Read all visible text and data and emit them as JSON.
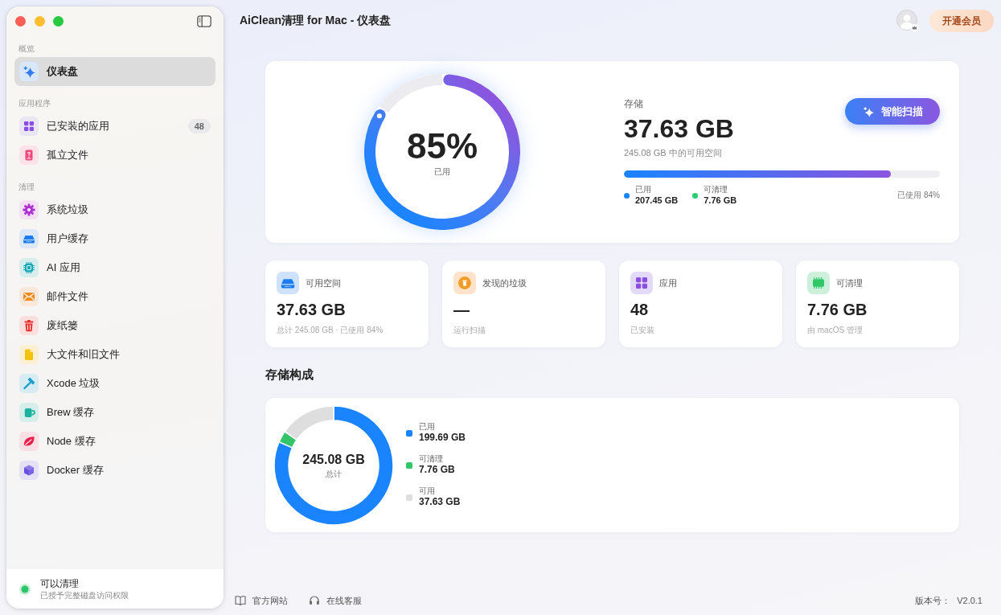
{
  "window": {
    "title": "AiClean清理 for Mac - 仪表盘"
  },
  "sidebar": {
    "sections": [
      {
        "title": "概览",
        "items": [
          {
            "label": "仪表盘",
            "selected": true
          }
        ]
      },
      {
        "title": "应用程序",
        "items": [
          {
            "label": "已安装的应用",
            "selected": false,
            "badge": "48"
          },
          {
            "label": "孤立文件",
            "selected": false
          }
        ]
      },
      {
        "title": "清理",
        "items": [
          {
            "label": "系统垃圾",
            "selected": false
          },
          {
            "label": "用户缓存",
            "selected": false
          },
          {
            "label": "AI 应用",
            "selected": false
          },
          {
            "label": "邮件文件",
            "selected": false
          },
          {
            "label": "废纸篓",
            "selected": false
          },
          {
            "label": "大文件和旧文件",
            "selected": false
          },
          {
            "label": "Xcode 垃圾",
            "selected": false
          },
          {
            "label": "Brew 缓存",
            "selected": false
          },
          {
            "label": "Node 缓存",
            "selected": false
          },
          {
            "label": "Docker 缓存",
            "selected": false
          }
        ]
      }
    ],
    "status": {
      "title": "可以清理",
      "detail": "已授予完整磁盘访问权限",
      "ok": true
    }
  },
  "header": {
    "upgrade_button": "开通会员"
  },
  "storage": {
    "ring": {
      "percent": "85%",
      "caption": "已用",
      "chart_data": {
        "type": "donut",
        "values": [
          85,
          15
        ]
      }
    },
    "label": "存储",
    "value": "37.63 GB",
    "detail": "245.08 GB 中的可用空间",
    "scan_button": "智能扫描",
    "bar": {
      "level": 0.846
    },
    "legend": [
      {
        "label": "已用",
        "value": "207.45 GB",
        "color": "#1a84ff"
      },
      {
        "label": "可清理",
        "value": "7.76 GB",
        "color": "#2ecc71"
      }
    ],
    "usage": "已使用 84%"
  },
  "stats": [
    {
      "label": "可用空间",
      "value": "37.63 GB",
      "detail": "总计 245.08 GB · 已使用 84%"
    },
    {
      "label": "发现的垃圾",
      "value": "—",
      "detail": "运行扫描"
    },
    {
      "label": "应用",
      "value": "48",
      "detail": "已安装"
    },
    {
      "label": "可清理",
      "value": "7.76 GB",
      "detail": "由 macOS 管理"
    }
  ],
  "composition": {
    "title": "存储构成",
    "total": "245.08 GB",
    "total_label": "总计",
    "chart_data": {
      "type": "donut",
      "categories": [
        "已用",
        "可清理",
        "可用"
      ],
      "values": [
        81.48,
        3.17,
        15.35
      ]
    },
    "legend": [
      {
        "value": "199.69 GB",
        "color": "#1a84ff"
      },
      {
        "value": "7.76 GB",
        "color": "#34c46a"
      },
      {
        "value": "37.63 GB",
        "color": "#dedede"
      }
    ]
  },
  "footer": {
    "links": [
      {
        "label": "官方网站"
      },
      {
        "label": "在线客服"
      }
    ],
    "version_label": "版本号：",
    "version": "V2.0.1"
  }
}
